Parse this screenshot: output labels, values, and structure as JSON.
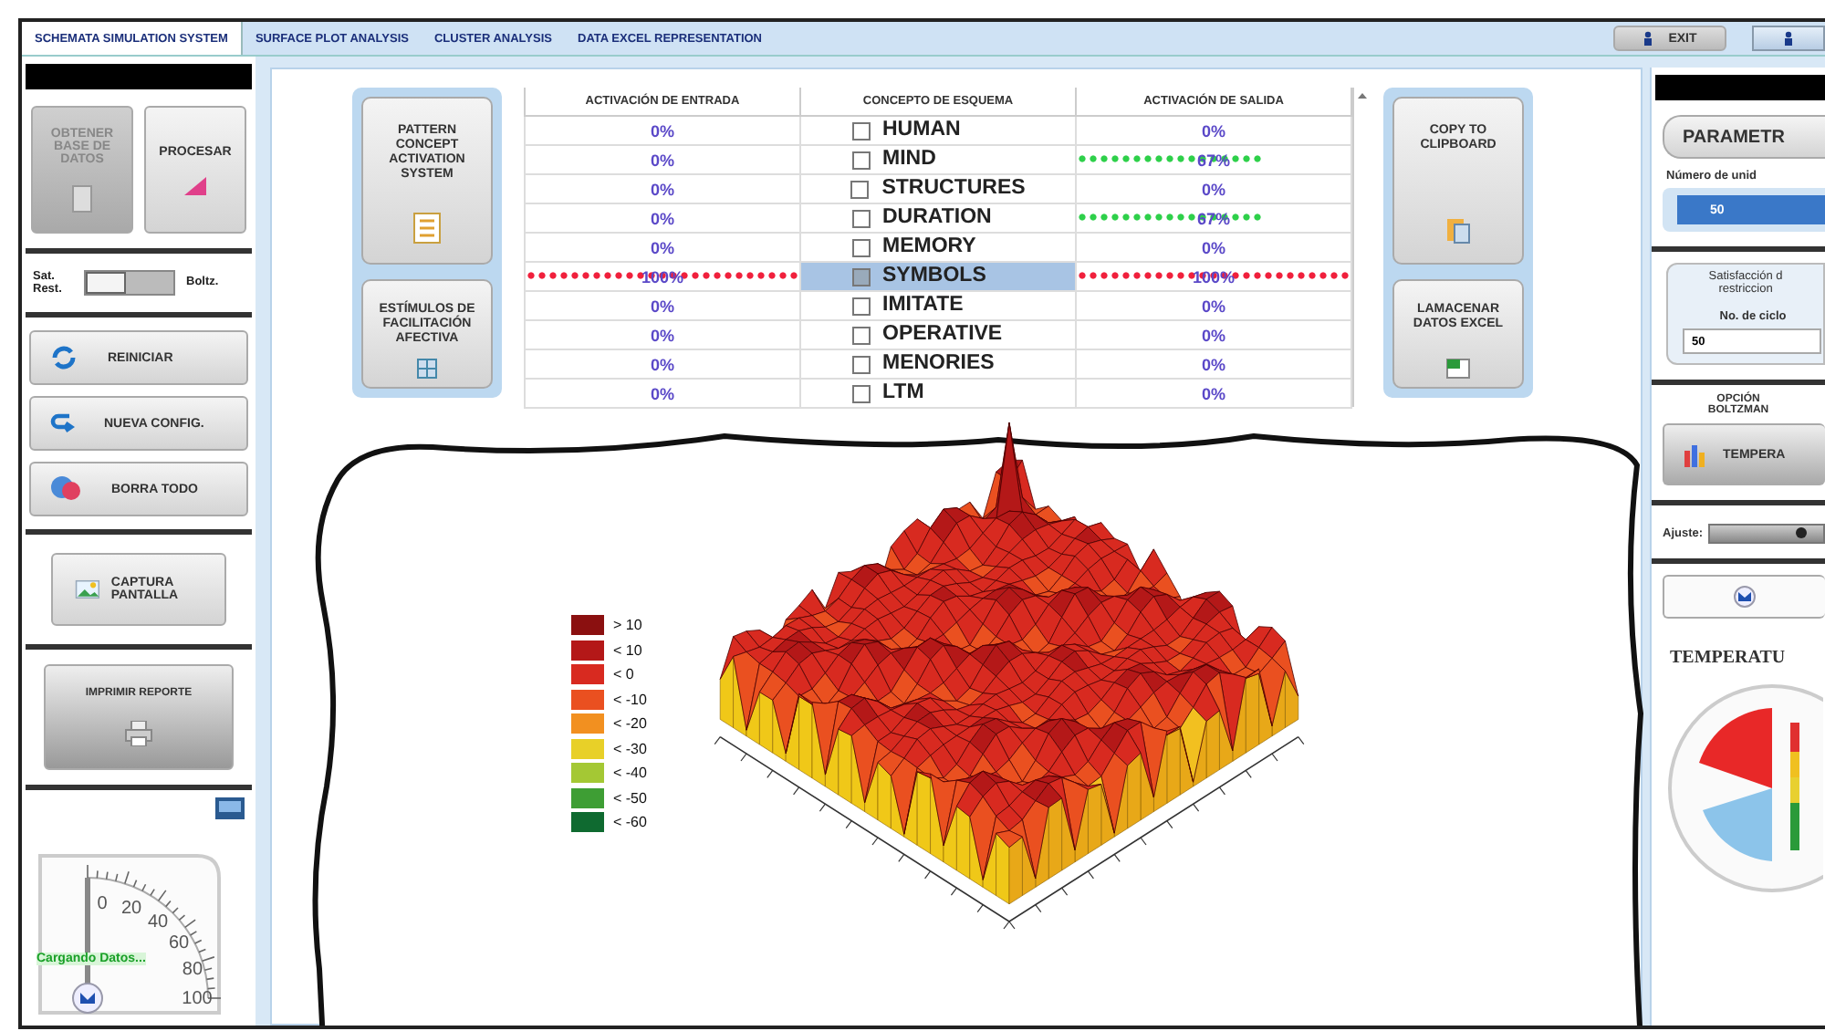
{
  "tabs": [
    {
      "label": "SCHEMATA SIMULATION SYSTEM",
      "selected": true
    },
    {
      "label": "SURFACE PLOT ANALYSIS",
      "selected": false
    },
    {
      "label": "CLUSTER ANALYSIS",
      "selected": false
    },
    {
      "label": "DATA EXCEL REPRESENTATION",
      "selected": false
    }
  ],
  "exit_button": "EXIT",
  "left_panel": {
    "top_buttons": [
      {
        "label": "OBTENER BASE DE DATOS",
        "disabled": true
      },
      {
        "label": "PROCESAR",
        "disabled": false
      }
    ],
    "mode_switch": {
      "left_label": "Sat. Rest.",
      "right_label": "Boltz.",
      "on": false
    },
    "actions": [
      "REINICIAR",
      "NUEVA CONFIG.",
      "BORRA TODO"
    ],
    "capture_button": "CAPTURA PANTALLA",
    "print_button": "IMPRIMIR REPORTE",
    "gauge": {
      "ticks": [
        "0",
        "20",
        "40",
        "60",
        "80",
        "100"
      ],
      "status": "Cargando Datos..."
    }
  },
  "left_buttons": [
    "PATTERN CONCEPT ACTIVATION SYSTEM",
    "ESTÍMULOS DE FACILITACIÓN AFECTIVA"
  ],
  "table": {
    "columns": [
      "ACTIVACIÓN DE ENTRADA",
      "CONCEPTO DE ESQUEMA",
      "ACTIVACIÓN DE SALIDA"
    ],
    "rows": [
      {
        "input": {
          "text": "0%"
        },
        "concept": "HUMAN",
        "checked": false,
        "output": {
          "text": "0%"
        },
        "selected": false
      },
      {
        "input": {
          "text": "0%"
        },
        "concept": "MIND",
        "checked": false,
        "output": {
          "text": "67%",
          "level": 0.67
        },
        "selected": false
      },
      {
        "input": {
          "text": "0%"
        },
        "concept": "STRUCTURES",
        "checked": false,
        "output": {
          "text": "0%"
        },
        "selected": false
      },
      {
        "input": {
          "text": "0%"
        },
        "concept": "DURATION",
        "checked": false,
        "output": {
          "text": "67%",
          "level": 0.67
        },
        "selected": false
      },
      {
        "input": {
          "text": "0%"
        },
        "concept": "MEMORY",
        "checked": false,
        "output": {
          "text": "0%"
        },
        "selected": false
      },
      {
        "input": {
          "text": "100%",
          "level": 1
        },
        "concept": "SYMBOLS",
        "checked": true,
        "output": {
          "text": "100%",
          "level": 1
        },
        "selected": true
      },
      {
        "input": {
          "text": "0%"
        },
        "concept": "IMITATE",
        "checked": false,
        "output": {
          "text": "0%"
        },
        "selected": false
      },
      {
        "input": {
          "text": "0%"
        },
        "concept": "OPERATIVE",
        "checked": false,
        "output": {
          "text": "0%"
        },
        "selected": false
      },
      {
        "input": {
          "text": "0%"
        },
        "concept": "MENORIES",
        "checked": false,
        "output": {
          "text": "0%"
        },
        "selected": false
      },
      {
        "input": {
          "text": "0%"
        },
        "concept": "LTM",
        "checked": false,
        "output": {
          "text": "0%"
        },
        "selected": false
      }
    ]
  },
  "right_buttons": [
    "COPY TO CLIPBOARD",
    "LAMACENAR DATOS EXCEL"
  ],
  "right_panel": {
    "title": "PARAMETR",
    "units_label": "Número de unid",
    "units_value": "50",
    "satisfaction_lines": [
      "Satisfacción d",
      "restriccion"
    ],
    "cycles_label": "No. de ciclo",
    "cycles_value": "50",
    "boltzmann_lines": [
      "OPCIÓN",
      "BOLTZMAN"
    ],
    "temperature_button": "TEMPERA",
    "adjust": {
      "label": "Ajuste:",
      "level": 0.8
    },
    "gauge_title": "TEMPERATU"
  },
  "plot": {
    "legend": [
      {
        "label": "> 10",
        "color": "#8b1010"
      },
      {
        "label": "< 10",
        "color": "#b41818"
      },
      {
        "label": "< 0",
        "color": "#d82a20"
      },
      {
        "label": "< -10",
        "color": "#ea5020"
      },
      {
        "label": "< -20",
        "color": "#f29020"
      },
      {
        "label": "< -30",
        "color": "#e8d028"
      },
      {
        "label": "< -40",
        "color": "#a4c834"
      },
      {
        "label": "< -50",
        "color": "#3e9e34"
      },
      {
        "label": "< -60",
        "color": "#0f6a30"
      }
    ]
  }
}
